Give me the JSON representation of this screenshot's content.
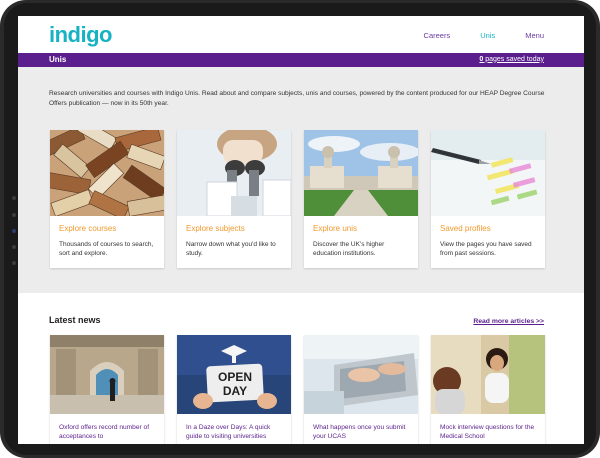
{
  "header": {
    "logo": "indigo",
    "nav": [
      {
        "label": "Careers"
      },
      {
        "label": "Unis"
      },
      {
        "label": "Menu"
      }
    ]
  },
  "section_bar": {
    "title": "Unis",
    "saved_count": "0",
    "saved_label": " pages saved today"
  },
  "intro": "Research universities and courses with Indigo Unis. Read about and compare subjects, unis and courses, powered by the content produced for our HEAP Degree Course Offers publication — now in its 50th year.",
  "explore_cards": [
    {
      "title": "Explore courses",
      "description": "Thousands of courses to search, sort and explore.",
      "icon": "books-image"
    },
    {
      "title": "Explore subjects",
      "description": "Narrow down what you'd like to study.",
      "icon": "microscope-image"
    },
    {
      "title": "Explore unis",
      "description": "Discover the UK's higher education institutions.",
      "icon": "university-image"
    },
    {
      "title": "Saved profiles",
      "description": "View the pages you have saved from past sessions.",
      "icon": "pen-notes-image"
    }
  ],
  "news": {
    "heading": "Latest news",
    "read_more": "Read more articles >>",
    "items": [
      {
        "title": "Oxford offers record number of acceptances to",
        "icon": "oxford-building-image"
      },
      {
        "title": "In a Daze over Days: A quick guide to visiting universities",
        "icon": "open-day-sign-image",
        "sign_line1": "OPEN",
        "sign_line2": "DAY"
      },
      {
        "title": "What happens once you submit your UCAS",
        "icon": "laptop-typing-image"
      },
      {
        "title": "Mock interview questions for the Medical School",
        "icon": "interview-image"
      }
    ]
  },
  "colors": {
    "brand_teal": "#17b3c4",
    "brand_purple": "#5a1f8c",
    "accent_orange": "#f29a2e"
  }
}
